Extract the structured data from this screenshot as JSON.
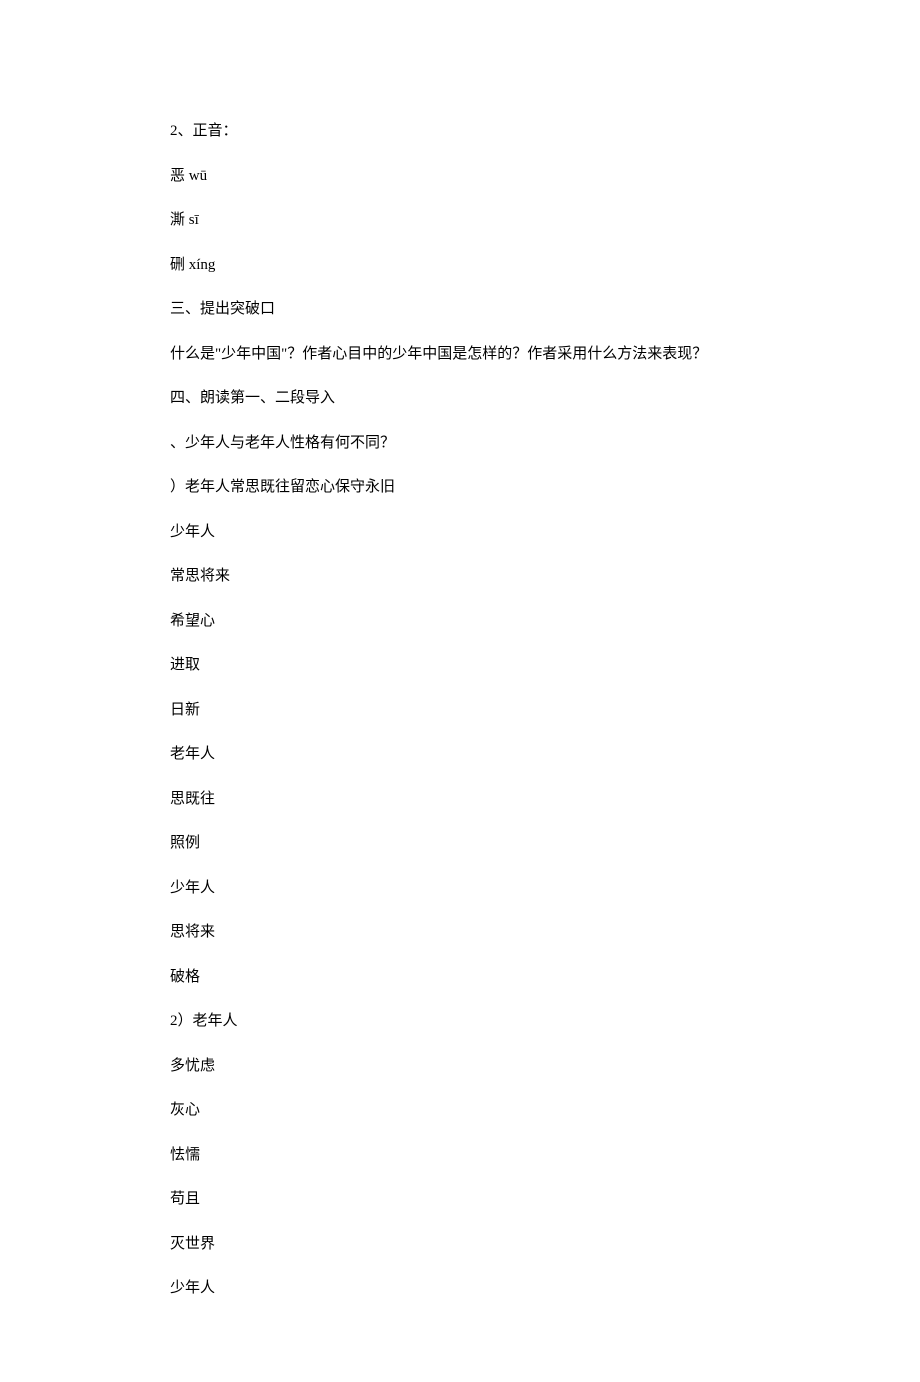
{
  "lines": {
    "l0": "2、正音：",
    "l1": "恶 wū",
    "l2": "澌 sī",
    "l3": "硎 xíng",
    "l4": "三、提出突破口",
    "l5": "什么是\"少年中国\"？作者心目中的少年中国是怎样的？作者采用什么方法来表现？",
    "l6": "四、朗读第一、二段导入",
    "l7": "、少年人与老年人性格有何不同？",
    "l8": "）老年人常思既往留恋心保守永旧",
    "l9": "少年人",
    "l10": "常思将来",
    "l11": "希望心",
    "l12": "进取",
    "l13": "日新",
    "l14": "老年人",
    "l15": "思既往",
    "l16": "照例",
    "l17": "少年人",
    "l18": "思将来",
    "l19": "破格",
    "l20": "2）老年人",
    "l21": "多忧虑",
    "l22": "灰心",
    "l23": "怯懦",
    "l24": "苟且",
    "l25": "灭世界",
    "l26": "少年人"
  }
}
